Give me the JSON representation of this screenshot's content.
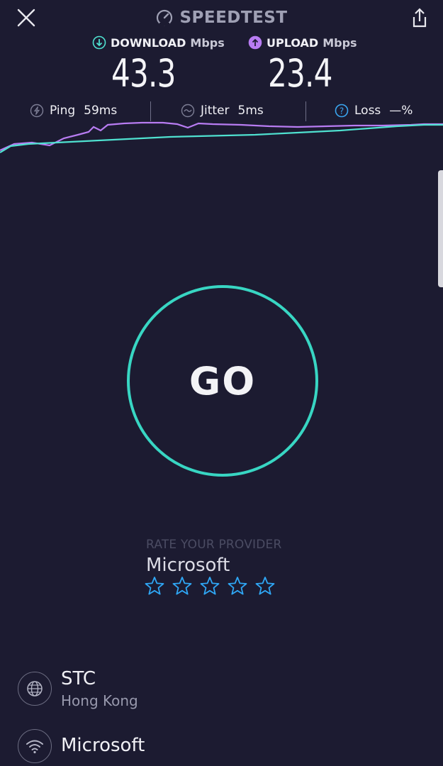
{
  "header": {
    "title": "SPEEDTEST"
  },
  "results": {
    "download": {
      "label": "DOWNLOAD",
      "unit": "Mbps",
      "value": "43.3"
    },
    "upload": {
      "label": "UPLOAD",
      "unit": "Mbps",
      "value": "23.4"
    }
  },
  "metrics": {
    "ping": {
      "label": "Ping",
      "value": "59ms"
    },
    "jitter": {
      "label": "Jitter",
      "value": "5ms"
    },
    "loss": {
      "label": "Loss",
      "value": "—%"
    }
  },
  "go_button": {
    "label": "GO"
  },
  "rating": {
    "label": "RATE YOUR PROVIDER",
    "provider": "Microsoft",
    "max_stars": 5,
    "selected_stars": 0
  },
  "connection": {
    "isp": {
      "name": "STC",
      "location": "Hong Kong"
    },
    "server": {
      "name": "Microsoft"
    }
  },
  "colors": {
    "background": "#1c1b31",
    "download_accent": "#4fe1d0",
    "upload_accent": "#b87cf2",
    "go_ring": "#38d6c3",
    "star": "#2fa7f5"
  },
  "icons": {
    "close": "close-icon",
    "share": "share-icon",
    "gauge": "gauge-icon",
    "download": "download-arrow-icon",
    "upload": "upload-arrow-icon",
    "ping": "ping-icon",
    "jitter": "jitter-icon",
    "loss": "help-icon",
    "isp": "globe-icon",
    "server": "wifi-icon",
    "star": "star-outline-icon"
  }
}
